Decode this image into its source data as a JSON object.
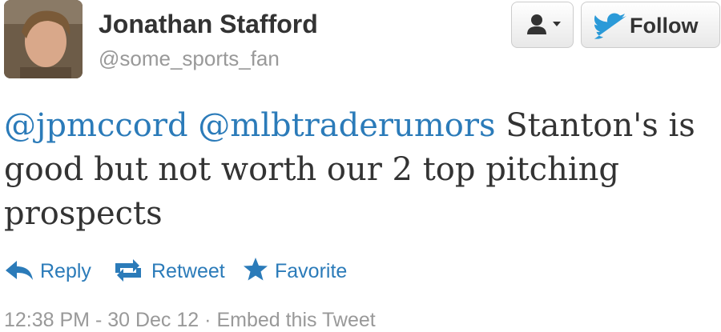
{
  "user": {
    "name": "Jonathan Stafford",
    "handle": "@some_sports_fan"
  },
  "buttons": {
    "follow_label": "Follow"
  },
  "tweet": {
    "mention1": "@jpmccord",
    "mention2": "@mlbtraderumors",
    "text": "Stanton's is good but not worth our 2 top pitching prospects"
  },
  "actions": {
    "reply": "Reply",
    "retweet": "Retweet",
    "favorite": "Favorite"
  },
  "meta": {
    "timestamp": "12:38 PM - 30 Dec 12",
    "separator": "·",
    "embed": "Embed this Tweet"
  },
  "colors": {
    "link": "#2b7bb9",
    "muted": "#999999",
    "text": "#333333"
  }
}
